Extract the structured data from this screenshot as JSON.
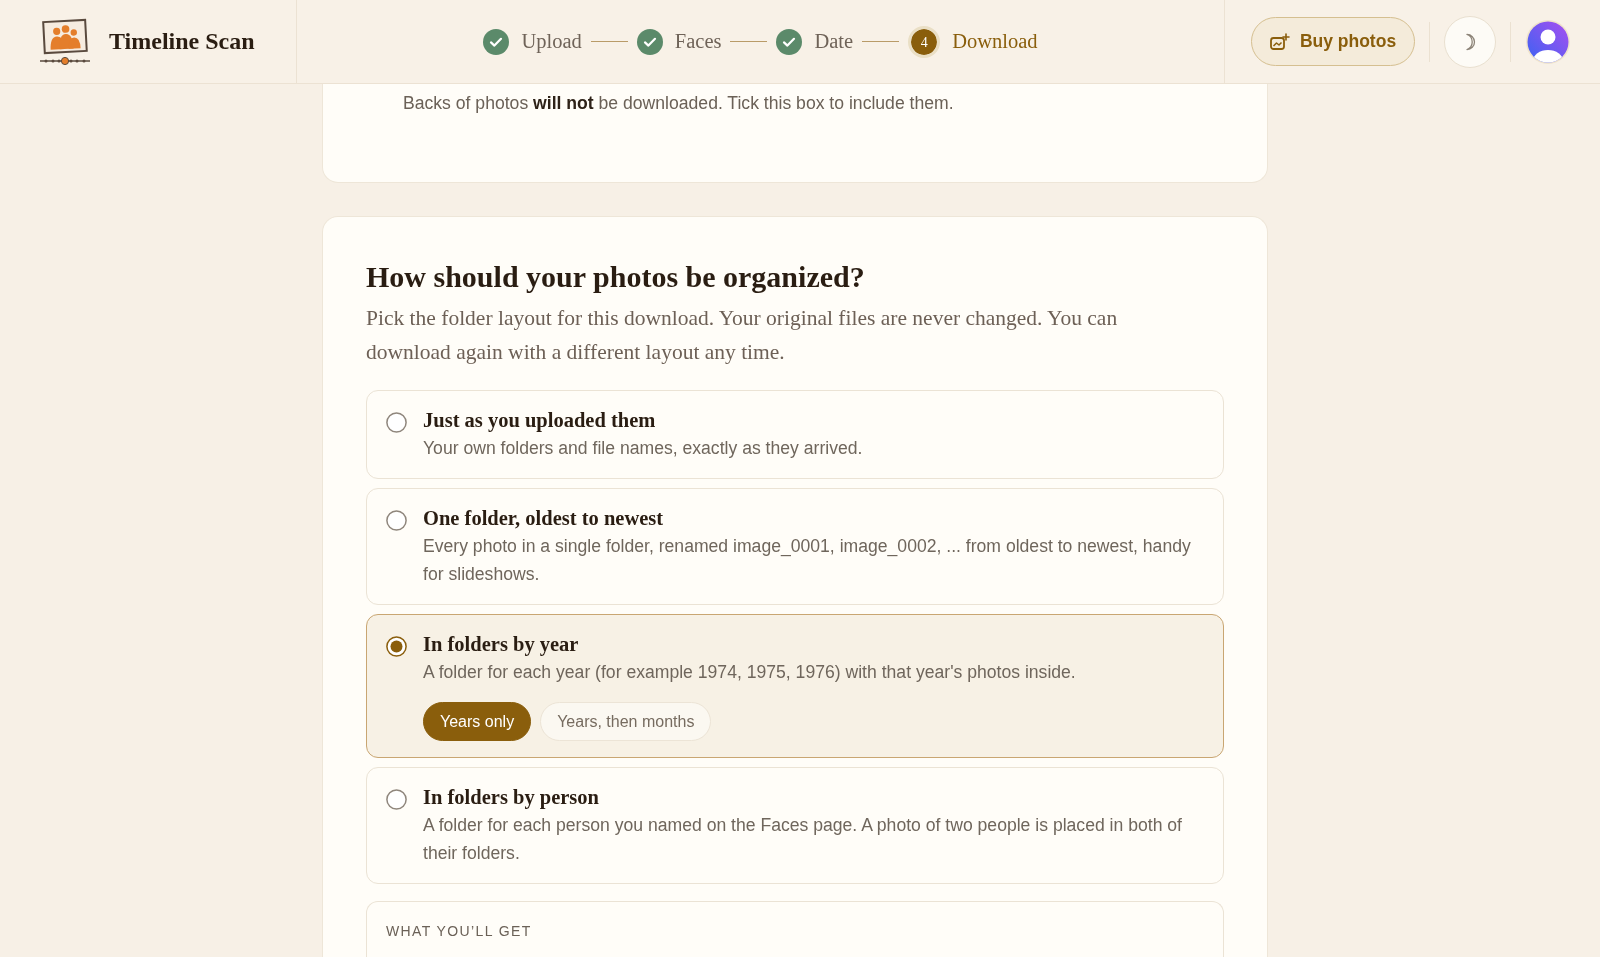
{
  "header": {
    "app_name": "Timeline Scan",
    "steps": [
      {
        "label": "Upload",
        "done": true,
        "selected": false
      },
      {
        "label": "Faces",
        "done": true,
        "selected": false
      },
      {
        "label": "Date",
        "done": true,
        "selected": false
      },
      {
        "label": "Download",
        "number": "4",
        "done": false,
        "selected": true
      }
    ],
    "buy_button": "Buy photos"
  },
  "backs_notice": "Backs of photos **will not** be downloaded. Tick this box to include them.",
  "organize": {
    "title": "How should your photos be organized?",
    "description": "Pick the folder layout for this download. Your original files are never changed. You can download again with a different layout any time.",
    "options": [
      {
        "title": "Just as you uploaded them",
        "description": "Your own folders and file names, exactly as they arrived.",
        "selected": false
      },
      {
        "title": "One folder, oldest to newest",
        "description": "Every photo in a single folder, renamed image_0001, image_0002, ... from oldest to newest, handy for slideshows.",
        "selected": false
      },
      {
        "title": "In folders by year",
        "description": "A folder for each year (for example 1974, 1975, 1976) with that year's photos inside.",
        "selected": true,
        "sub_options": [
          {
            "label": "Years only",
            "selected": true
          },
          {
            "label": "Years, then months",
            "selected": false
          }
        ]
      },
      {
        "title": "In folders by person",
        "description": "A folder for each person you named on the Faces page. A photo of two people is placed in both of their folders.",
        "selected": false
      }
    ]
  },
  "summary": {
    "heading": "WHAT YOU’LL GET"
  }
}
